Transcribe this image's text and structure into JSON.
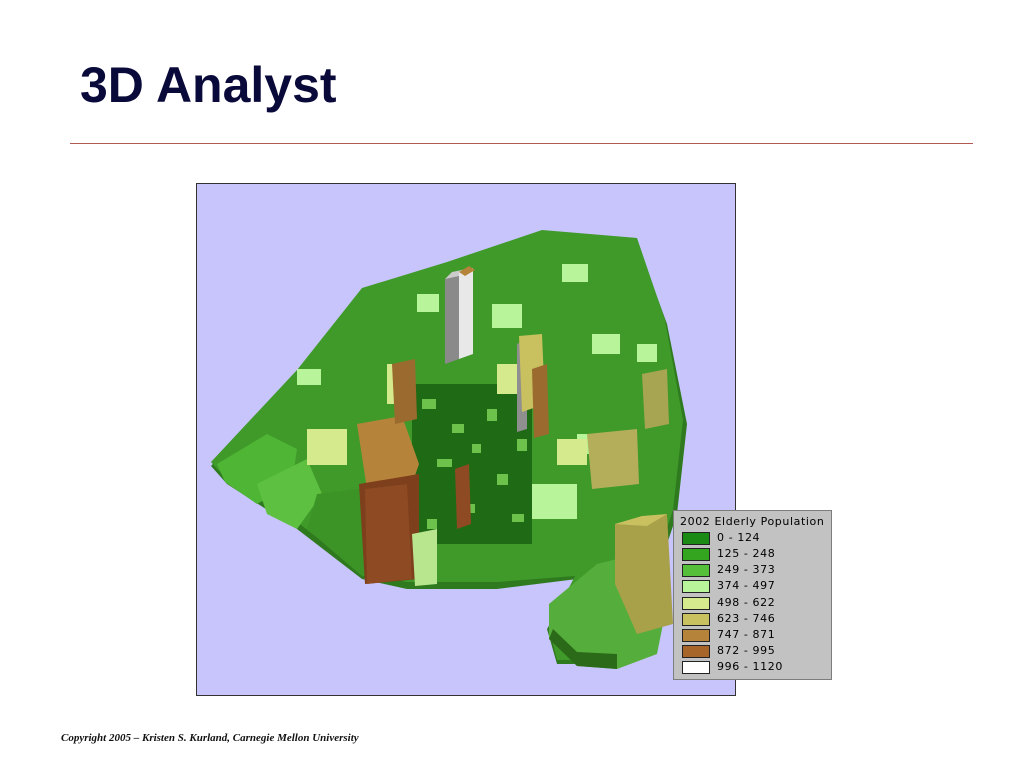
{
  "slide": {
    "title": "3D Analyst",
    "footer": "Copyright 2005 – Kristen S. Kurland, Carnegie Mellon University"
  },
  "map": {
    "background_color": "#c7c5fb"
  },
  "legend": {
    "title": "2002 Elderly Population",
    "items": [
      {
        "label": "0 - 124",
        "color": "#1a8a14"
      },
      {
        "label": "125 - 248",
        "color": "#33a51e"
      },
      {
        "label": "249 - 373",
        "color": "#55bf3a"
      },
      {
        "label": "374 - 497",
        "color": "#b8f59a"
      },
      {
        "label": "498 - 622",
        "color": "#d4ea8c"
      },
      {
        "label": "623 - 746",
        "color": "#c9c060"
      },
      {
        "label": "747 - 871",
        "color": "#b5843a"
      },
      {
        "label": "872 - 995",
        "color": "#a8652a"
      },
      {
        "label": "996 - 1120",
        "color": "#ffffff"
      }
    ]
  }
}
